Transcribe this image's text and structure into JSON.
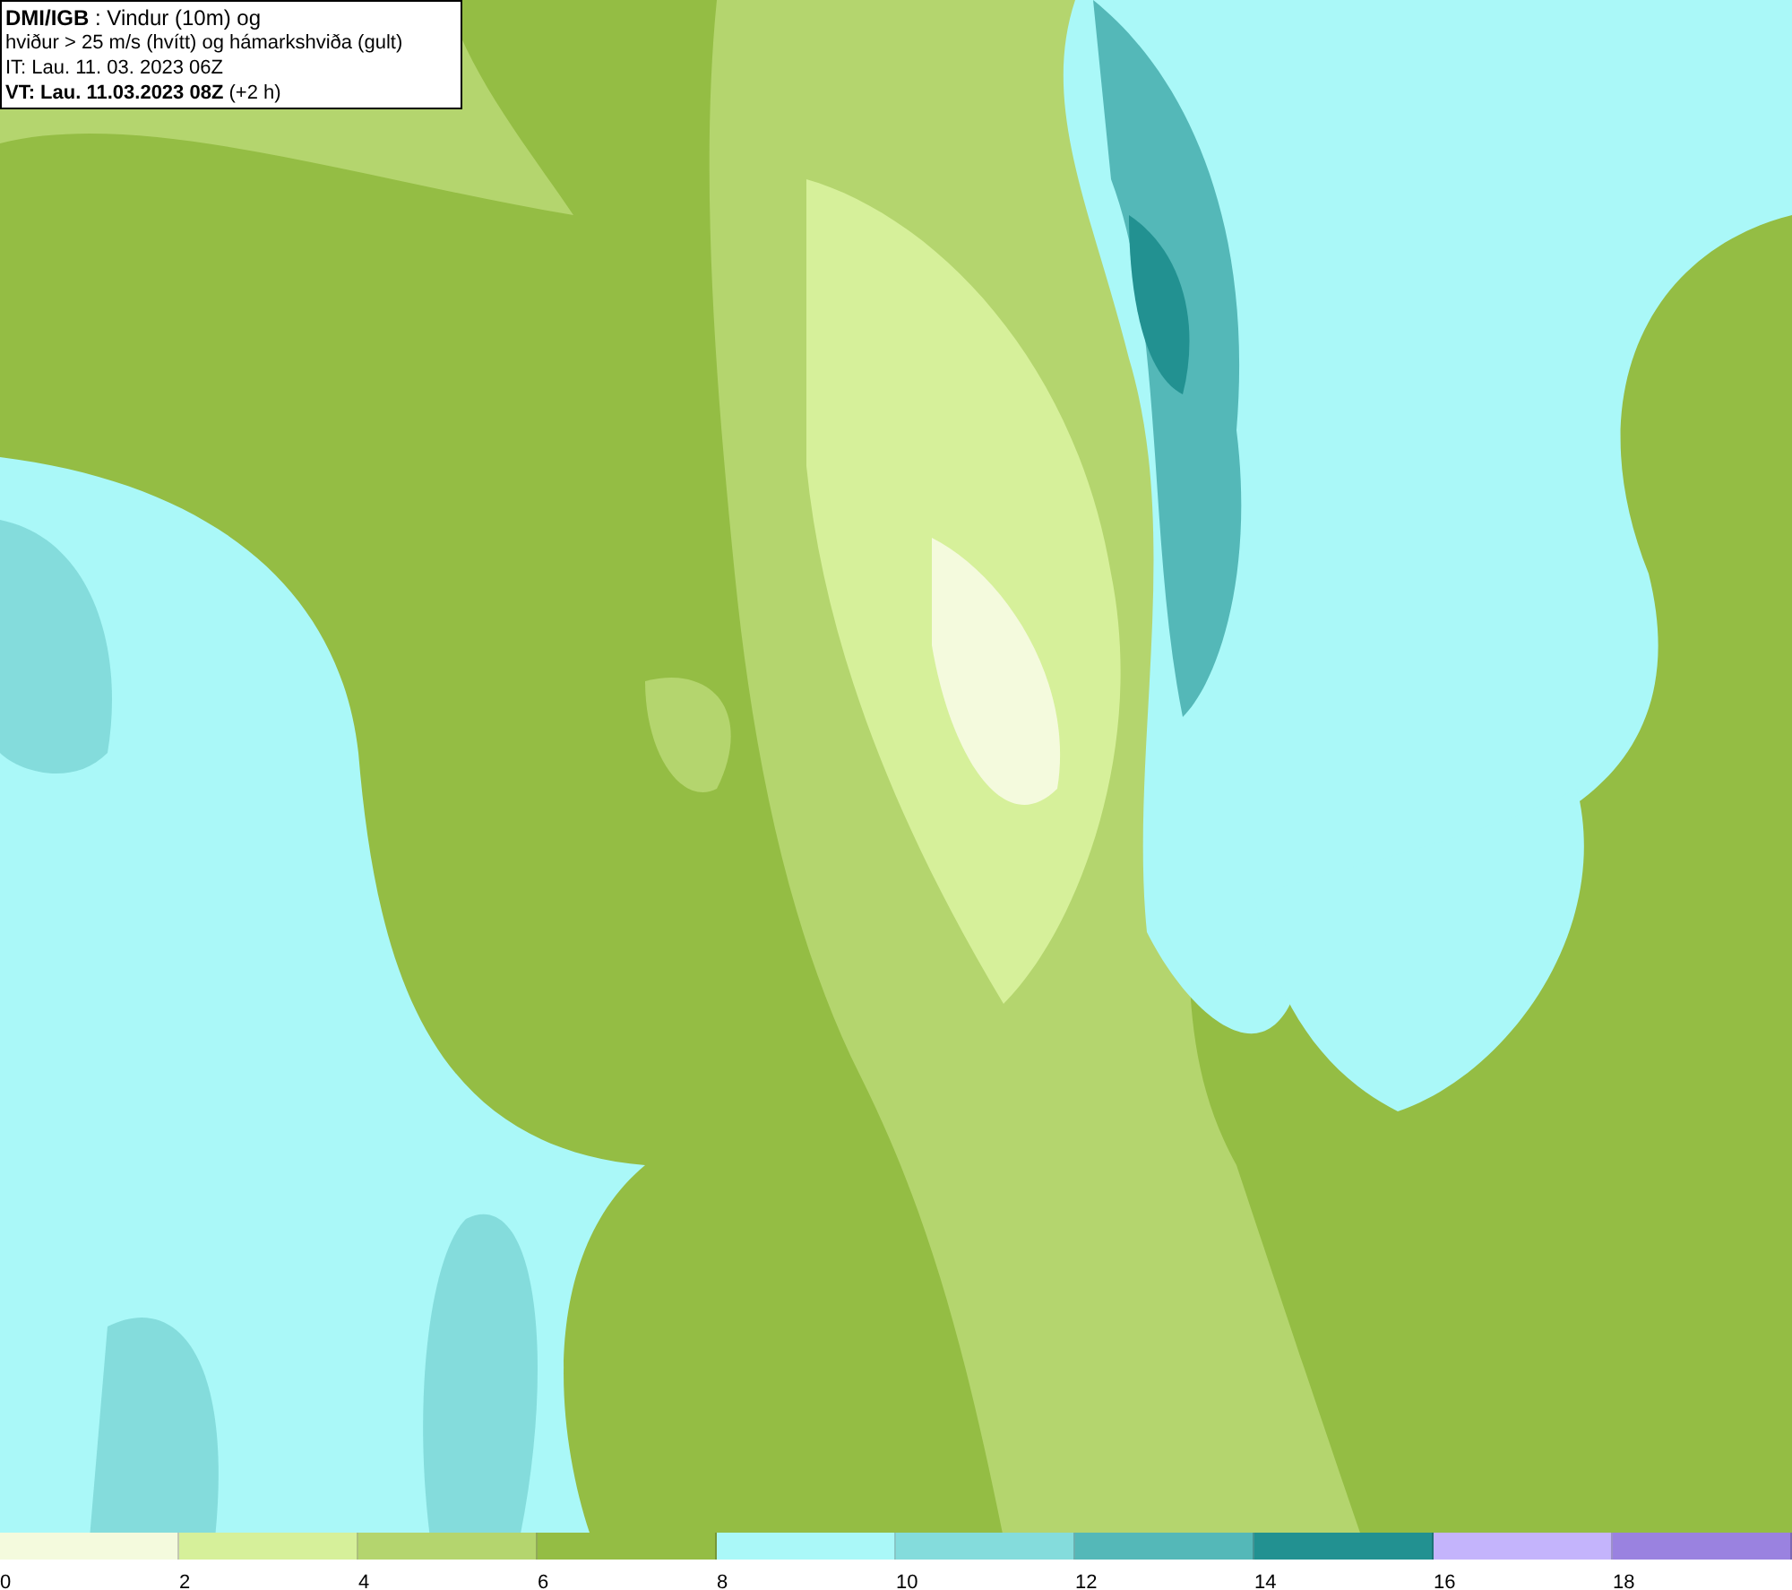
{
  "title_box": {
    "lines": [
      "**DMI/IGB** : Vindur (10m) og",
      "hviður > 25 m/s (hvítt) og hámarkshviða (gult)",
      "IT: Lau. 11. 03. 2023 06Z",
      "**VT: Lau. 11.03.2023 08Z** (+2 h)"
    ]
  },
  "legend": [
    {
      "label": "0",
      "color": "#f4fadd"
    },
    {
      "label": "2",
      "color": "#d6f09a"
    },
    {
      "label": "4",
      "color": "#b4d56e"
    },
    {
      "label": "6",
      "color": "#94bd44"
    },
    {
      "label": "8",
      "color": "#aaf8f8"
    },
    {
      "label": "10",
      "color": "#84dcdc"
    },
    {
      "label": "12",
      "color": "#54b8b8"
    },
    {
      "label": "14",
      "color": "#229191"
    },
    {
      "label": "16",
      "color": "#c4b4fc"
    },
    {
      "label": "18",
      "color": "#9a82e0"
    }
  ]
}
